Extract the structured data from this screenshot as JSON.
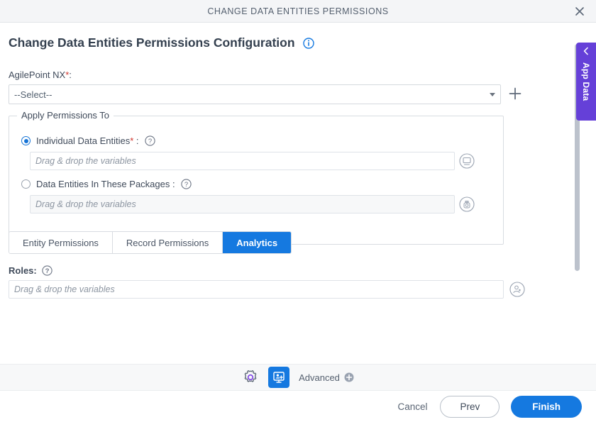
{
  "window": {
    "title": "CHANGE DATA ENTITIES PERMISSIONS",
    "close_icon": "close-icon"
  },
  "page": {
    "heading": "Change Data Entities Permissions Configuration",
    "heading_info_icon": "info-icon"
  },
  "agilepoint": {
    "label": "AgilePoint NX",
    "required_mark": "*",
    "label_suffix": ":",
    "selected_value": "--Select--",
    "caret_icon": "chevron-down-icon",
    "add_icon": "plus-icon"
  },
  "apply_permissions": {
    "legend": "Apply Permissions To",
    "options": [
      {
        "label": "Individual Data Entities",
        "required_mark": "*",
        "label_suffix": " :",
        "selected": true,
        "help_icon": "help-circle-icon",
        "input_placeholder": "Drag & drop the variables",
        "input_value": "",
        "picker_icon": "screen-circle-icon",
        "disabled": false
      },
      {
        "label": "Data Entities In These Packages",
        "required_mark": "",
        "label_suffix": " :",
        "selected": false,
        "help_icon": "help-circle-icon",
        "input_placeholder": "Drag & drop the variables",
        "input_value": "",
        "picker_icon": "package-circle-icon",
        "disabled": true
      }
    ]
  },
  "tabs": [
    {
      "label": "Entity Permissions",
      "active": false
    },
    {
      "label": "Record Permissions",
      "active": false
    },
    {
      "label": "Analytics",
      "active": true
    }
  ],
  "roles": {
    "label": "Roles:",
    "help_icon": "help-circle-icon",
    "placeholder": "Drag & drop the variables",
    "value": "",
    "picker_icon": "user-star-circle-icon"
  },
  "app_data_panel": {
    "label": "App Data",
    "collapse_icon": "chevron-left-icon",
    "color": "#6540d8"
  },
  "toolbar": {
    "settings_icon": "gear-icon",
    "screen_add_icon": "add-to-screen-icon",
    "advanced_label": "Advanced",
    "advanced_icon": "plus-circle-icon"
  },
  "footer": {
    "cancel_label": "Cancel",
    "prev_label": "Prev",
    "finish_label": "Finish"
  },
  "colors": {
    "accent": "#1579e0",
    "purple": "#6540d8",
    "required": "#d0342c"
  }
}
